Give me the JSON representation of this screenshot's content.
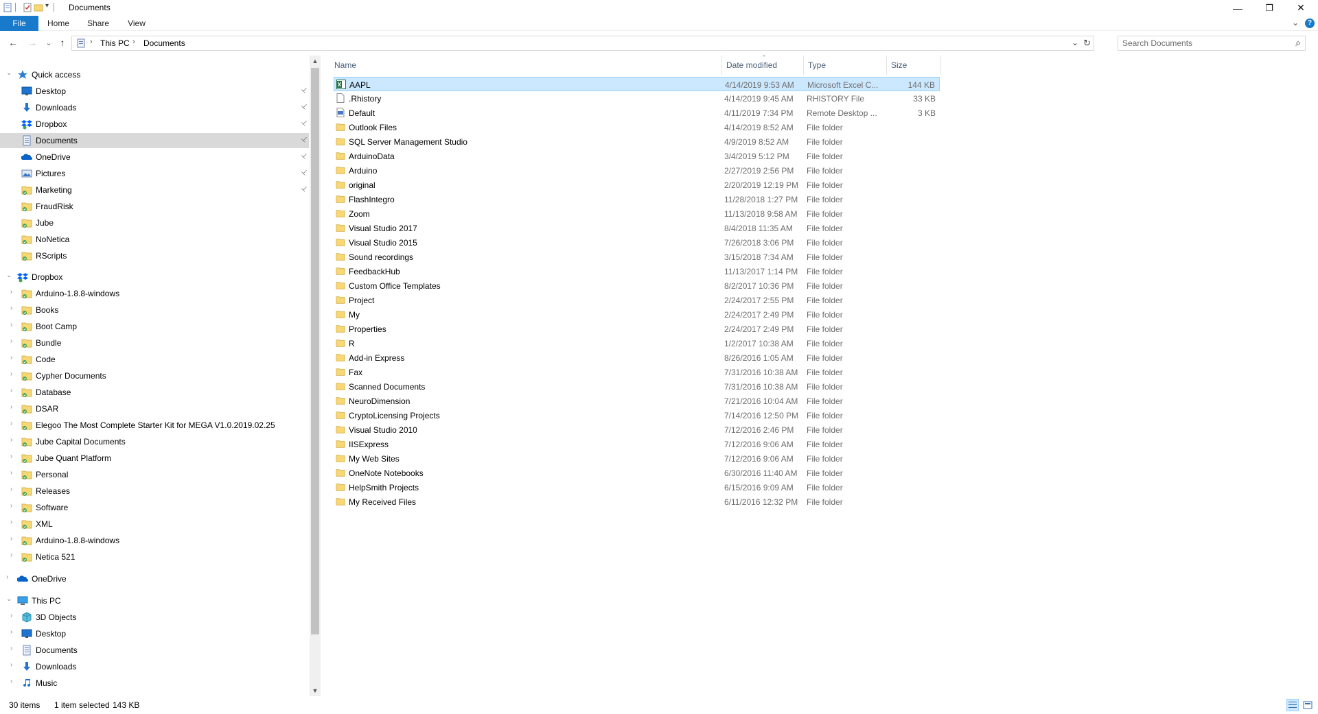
{
  "window": {
    "title": "Documents",
    "minimize_glyph": "—",
    "restore_glyph": "❐",
    "close_glyph": "✕"
  },
  "ribbon": {
    "tabs": [
      "File",
      "Home",
      "Share",
      "View"
    ],
    "collapse_glyph": "⌄",
    "help_glyph": "?"
  },
  "addressbar": {
    "back_glyph": "←",
    "forward_glyph": "→",
    "recent_glyph": "⌄",
    "up_glyph": "↑",
    "crumbs": [
      "This PC",
      "Documents"
    ],
    "chevron": "›",
    "dropdown_glyph": "⌄",
    "refresh_glyph": "↻"
  },
  "search": {
    "placeholder": "Search Documents",
    "icon_glyph": "⌕"
  },
  "navpane": {
    "pin_glyph": "📌",
    "expand_glyph": "›",
    "collapse_glyph": "⌄",
    "quick_access": {
      "label": "Quick access",
      "items": [
        {
          "label": "Desktop",
          "icon": "desktop-icon",
          "pinned": true
        },
        {
          "label": "Downloads",
          "icon": "downloads-icon",
          "pinned": true
        },
        {
          "label": "Dropbox",
          "icon": "dropbox-icon",
          "pinned": true
        },
        {
          "label": "Documents",
          "icon": "documents-icon",
          "pinned": true
        },
        {
          "label": "OneDrive",
          "icon": "onedrive-icon",
          "pinned": true
        },
        {
          "label": "Pictures",
          "icon": "pictures-icon",
          "pinned": true
        },
        {
          "label": "Marketing",
          "icon": "folder-sync-icon",
          "pinned": true
        },
        {
          "label": "FraudRisk",
          "icon": "folder-sync-icon",
          "pinned": false
        },
        {
          "label": "Jube",
          "icon": "folder-sync-icon",
          "pinned": false
        },
        {
          "label": "NoNetica",
          "icon": "folder-sync-icon",
          "pinned": false
        },
        {
          "label": "RScripts",
          "icon": "folder-sync-icon",
          "pinned": false
        }
      ]
    },
    "dropbox": {
      "label": "Dropbox",
      "items": [
        "Arduino-1.8.8-windows",
        "Books",
        "Boot Camp",
        "Bundle",
        "Code",
        "Cypher Documents",
        "Database",
        "DSAR",
        "Elegoo The Most Complete Starter Kit for MEGA V1.0.2019.02.25",
        "Jube Capital Documents",
        "Jube Quant Platform",
        "Personal",
        "Releases",
        "Software",
        "XML",
        "Arduino-1.8.8-windows",
        "Netica 521"
      ]
    },
    "onedrive": {
      "label": "OneDrive"
    },
    "this_pc": {
      "label": "This PC",
      "items": [
        {
          "label": "3D Objects",
          "icon": "3d-objects-icon"
        },
        {
          "label": "Desktop",
          "icon": "desktop-icon"
        },
        {
          "label": "Documents",
          "icon": "documents-icon"
        },
        {
          "label": "Downloads",
          "icon": "downloads-icon"
        },
        {
          "label": "Music",
          "icon": "music-icon"
        }
      ]
    },
    "scroll_up_glyph": "▲",
    "scroll_down_glyph": "▼"
  },
  "filelist": {
    "columns": [
      "Name",
      "Date modified",
      "Type",
      "Size"
    ],
    "sort_glyph": "⌃",
    "rows": [
      {
        "name": "AAPL",
        "date": "4/14/2019 9:53 AM",
        "type": "Microsoft Excel C...",
        "size": "144 KB",
        "icon": "excel-icon",
        "selected": true
      },
      {
        "name": ".Rhistory",
        "date": "4/14/2019 9:45 AM",
        "type": "RHISTORY File",
        "size": "33 KB",
        "icon": "file-icon"
      },
      {
        "name": "Default",
        "date": "4/11/2019 7:34 PM",
        "type": "Remote Desktop ...",
        "size": "3 KB",
        "icon": "rdp-icon"
      },
      {
        "name": "Outlook Files",
        "date": "4/14/2019 8:52 AM",
        "type": "File folder",
        "size": "",
        "icon": "folder-icon"
      },
      {
        "name": "SQL Server Management Studio",
        "date": "4/9/2019 8:52 AM",
        "type": "File folder",
        "size": "",
        "icon": "folder-icon"
      },
      {
        "name": "ArduinoData",
        "date": "3/4/2019 5:12 PM",
        "type": "File folder",
        "size": "",
        "icon": "folder-icon"
      },
      {
        "name": "Arduino",
        "date": "2/27/2019 2:56 PM",
        "type": "File folder",
        "size": "",
        "icon": "folder-icon"
      },
      {
        "name": "original",
        "date": "2/20/2019 12:19 PM",
        "type": "File folder",
        "size": "",
        "icon": "folder-icon"
      },
      {
        "name": "FlashIntegro",
        "date": "11/28/2018 1:27 PM",
        "type": "File folder",
        "size": "",
        "icon": "folder-icon"
      },
      {
        "name": "Zoom",
        "date": "11/13/2018 9:58 AM",
        "type": "File folder",
        "size": "",
        "icon": "folder-icon"
      },
      {
        "name": "Visual Studio 2017",
        "date": "8/4/2018 11:35 AM",
        "type": "File folder",
        "size": "",
        "icon": "folder-icon"
      },
      {
        "name": "Visual Studio 2015",
        "date": "7/26/2018 3:06 PM",
        "type": "File folder",
        "size": "",
        "icon": "folder-icon"
      },
      {
        "name": "Sound recordings",
        "date": "3/15/2018 7:34 AM",
        "type": "File folder",
        "size": "",
        "icon": "folder-icon"
      },
      {
        "name": "FeedbackHub",
        "date": "11/13/2017 1:14 PM",
        "type": "File folder",
        "size": "",
        "icon": "folder-icon"
      },
      {
        "name": "Custom Office Templates",
        "date": "8/2/2017 10:36 PM",
        "type": "File folder",
        "size": "",
        "icon": "folder-icon"
      },
      {
        "name": "Project",
        "date": "2/24/2017 2:55 PM",
        "type": "File folder",
        "size": "",
        "icon": "folder-icon"
      },
      {
        "name": "My",
        "date": "2/24/2017 2:49 PM",
        "type": "File folder",
        "size": "",
        "icon": "folder-icon"
      },
      {
        "name": "Properties",
        "date": "2/24/2017 2:49 PM",
        "type": "File folder",
        "size": "",
        "icon": "folder-icon"
      },
      {
        "name": "R",
        "date": "1/2/2017 10:38 AM",
        "type": "File folder",
        "size": "",
        "icon": "folder-icon"
      },
      {
        "name": "Add-in Express",
        "date": "8/26/2016 1:05 AM",
        "type": "File folder",
        "size": "",
        "icon": "folder-icon"
      },
      {
        "name": "Fax",
        "date": "7/31/2016 10:38 AM",
        "type": "File folder",
        "size": "",
        "icon": "folder-icon"
      },
      {
        "name": "Scanned Documents",
        "date": "7/31/2016 10:38 AM",
        "type": "File folder",
        "size": "",
        "icon": "folder-icon"
      },
      {
        "name": "NeuroDimension",
        "date": "7/21/2016 10:04 AM",
        "type": "File folder",
        "size": "",
        "icon": "folder-icon"
      },
      {
        "name": "CryptoLicensing Projects",
        "date": "7/14/2016 12:50 PM",
        "type": "File folder",
        "size": "",
        "icon": "folder-icon"
      },
      {
        "name": "Visual Studio 2010",
        "date": "7/12/2016 2:46 PM",
        "type": "File folder",
        "size": "",
        "icon": "folder-icon"
      },
      {
        "name": "IISExpress",
        "date": "7/12/2016 9:06 AM",
        "type": "File folder",
        "size": "",
        "icon": "folder-icon"
      },
      {
        "name": "My Web Sites",
        "date": "7/12/2016 9:06 AM",
        "type": "File folder",
        "size": "",
        "icon": "folder-icon"
      },
      {
        "name": "OneNote Notebooks",
        "date": "6/30/2016 11:40 AM",
        "type": "File folder",
        "size": "",
        "icon": "folder-icon"
      },
      {
        "name": "HelpSmith Projects",
        "date": "6/15/2016 9:09 AM",
        "type": "File folder",
        "size": "",
        "icon": "folder-icon"
      },
      {
        "name": "My Received Files",
        "date": "6/11/2016 12:32 PM",
        "type": "File folder",
        "size": "",
        "icon": "folder-icon"
      }
    ]
  },
  "statusbar": {
    "item_count": "30 items",
    "selection": "1 item selected",
    "selection_size": "143 KB"
  },
  "colors": {
    "accent": "#1979ca",
    "selection": "#cce8ff",
    "selection_border": "#99d1ff",
    "folder": "#f8d775",
    "secondary_text": "#6d6d6d",
    "header_text": "#4c607a"
  }
}
